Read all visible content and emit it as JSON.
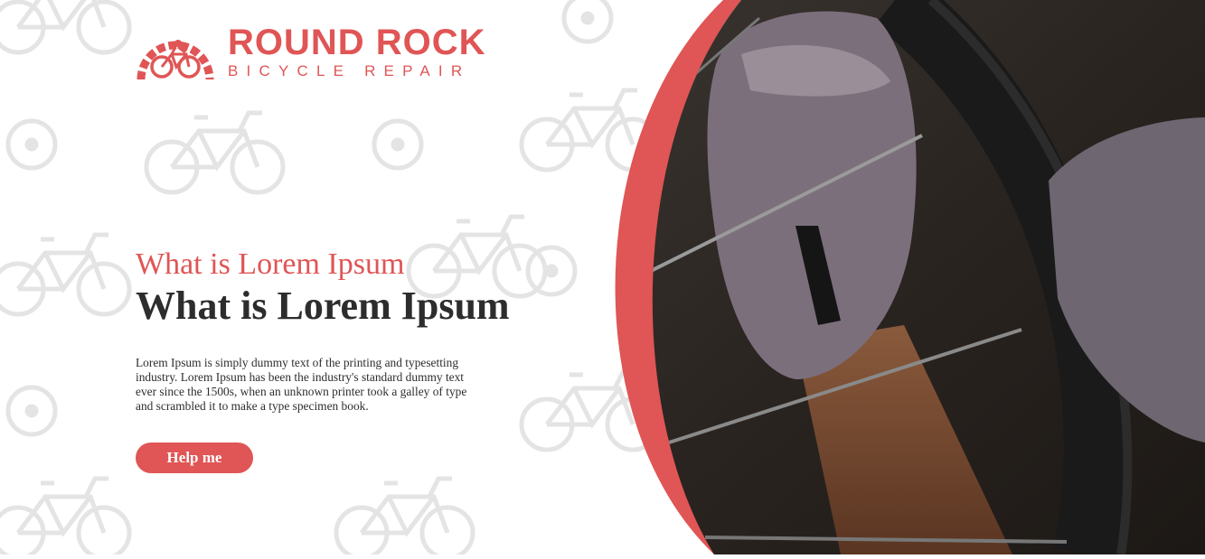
{
  "brand": {
    "name": "ROUND ROCK",
    "tagline": "BICYCLE REPAIR",
    "accent_color": "#e05555",
    "logo_icon": "bicycle-gear-icon"
  },
  "hero": {
    "subtitle": "What is Lorem Ipsum",
    "title": "What is Lorem Ipsum",
    "body": "Lorem Ipsum is simply dummy text of the printing and typesetting industry. Lorem Ipsum has been the industry's standard dummy text ever since the 1500s, when an unknown printer took a galley of type and scrambled it to make a type specimen book.",
    "cta_label": "Help me"
  },
  "photo": {
    "subject": "mechanic-hands-wheel-photo",
    "frame_color": "#e05555"
  }
}
